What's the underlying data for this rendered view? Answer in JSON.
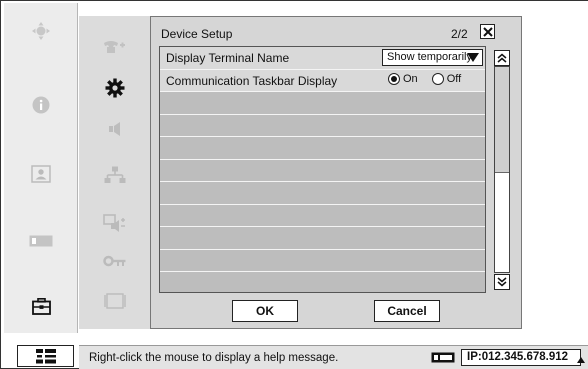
{
  "dialog": {
    "title": "Device Setup",
    "page": "2/2",
    "rows": [
      {
        "label": "Display Terminal Name",
        "control": "select",
        "value": "Show temporarily"
      },
      {
        "label": "Communication Taskbar Display",
        "control": "radio",
        "options": [
          "On",
          "Off"
        ],
        "selected": "On"
      }
    ],
    "ok_label": "OK",
    "cancel_label": "Cancel"
  },
  "status_bar": {
    "help_text": "Right-click the mouse to display a help message.",
    "ip": "IP:012.345.678.912"
  },
  "left_menu": {
    "icons": [
      "move-icon",
      "info-icon",
      "contacts-icon",
      "card-icon",
      "toolbox-icon"
    ]
  },
  "sub_menu": {
    "icons": [
      "phone-icon",
      "gear-icon",
      "speaker-icon",
      "network-icon",
      "video-audio-icon",
      "key-icon",
      "screen-icon"
    ]
  },
  "colors": {
    "dialog_bg": "#d6d6d6",
    "row_bg": "#d9d9d9",
    "empty_row_bg": "#bdbdbd"
  }
}
